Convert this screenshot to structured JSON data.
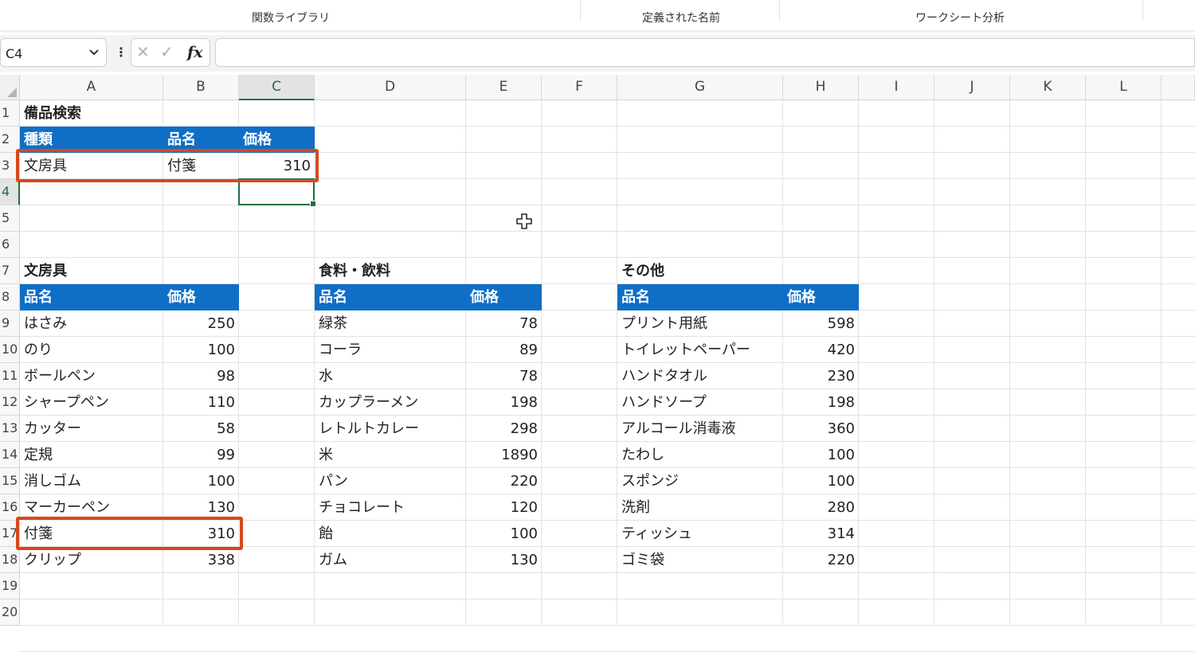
{
  "ribbon": {
    "groups": [
      "関数ライブラリ",
      "定義された名前",
      "ワークシート分析"
    ]
  },
  "formula_bar": {
    "name_box": "C4",
    "name_box_chevron": "chevron-down-icon",
    "more_icon": "⋮",
    "cancel_icon": "✕",
    "enter_icon": "✓",
    "fx_label": "fx",
    "formula": ""
  },
  "columns": [
    "A",
    "B",
    "C",
    "D",
    "E",
    "F",
    "G",
    "H",
    "I",
    "J",
    "K",
    "L"
  ],
  "rows": [
    "1",
    "2",
    "3",
    "4",
    "5",
    "6",
    "7",
    "8",
    "9",
    "10",
    "11",
    "12",
    "13",
    "14",
    "15",
    "16",
    "17",
    "18",
    "19",
    "20"
  ],
  "active_cell": "C4",
  "search": {
    "title": "備品検索",
    "headers": [
      "種類",
      "品名",
      "価格"
    ],
    "result": {
      "type": "文房具",
      "item": "付箋",
      "price": "310"
    }
  },
  "tables": [
    {
      "title": "文房具",
      "headers": [
        "品名",
        "価格"
      ],
      "rows": [
        [
          "はさみ",
          "250"
        ],
        [
          "のり",
          "100"
        ],
        [
          "ボールペン",
          "98"
        ],
        [
          "シャープペン",
          "110"
        ],
        [
          "カッター",
          "58"
        ],
        [
          "定規",
          "99"
        ],
        [
          "消しゴム",
          "100"
        ],
        [
          "マーカーペン",
          "130"
        ],
        [
          "付箋",
          "310"
        ],
        [
          "クリップ",
          "338"
        ]
      ]
    },
    {
      "title": "食料・飲料",
      "headers": [
        "品名",
        "価格"
      ],
      "rows": [
        [
          "緑茶",
          "78"
        ],
        [
          "コーラ",
          "89"
        ],
        [
          "水",
          "78"
        ],
        [
          "カップラーメン",
          "198"
        ],
        [
          "レトルトカレー",
          "298"
        ],
        [
          "米",
          "1890"
        ],
        [
          "パン",
          "220"
        ],
        [
          "チョコレート",
          "120"
        ],
        [
          "飴",
          "100"
        ],
        [
          "ガム",
          "130"
        ]
      ]
    },
    {
      "title": "その他",
      "headers": [
        "品名",
        "価格"
      ],
      "rows": [
        [
          "プリント用紙",
          "598"
        ],
        [
          "トイレットペーパー",
          "420"
        ],
        [
          "ハンドタオル",
          "230"
        ],
        [
          "ハンドソープ",
          "198"
        ],
        [
          "アルコール消毒液",
          "360"
        ],
        [
          "たわし",
          "100"
        ],
        [
          "スポンジ",
          "100"
        ],
        [
          "洗剤",
          "280"
        ],
        [
          "ティッシュ",
          "314"
        ],
        [
          "ゴミ袋",
          "220"
        ]
      ]
    }
  ],
  "colors": {
    "header_fill": "#0f6fc6",
    "highlight": "#d9481a",
    "selection": "#1e7145"
  }
}
